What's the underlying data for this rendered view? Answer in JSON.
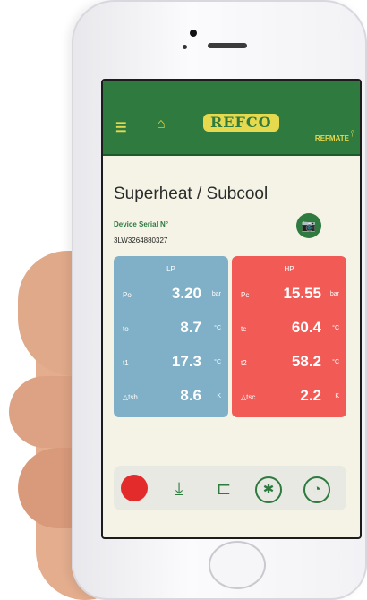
{
  "app": {
    "logo": "REFCO",
    "brand": "REFMATE"
  },
  "header": {
    "menu_icon": "☰",
    "home_icon": "⌂",
    "refmate_icon": "⫯"
  },
  "page": {
    "title": "Superheat / Subcool"
  },
  "device": {
    "serial_label": "Device Serial N°",
    "serial_value": "3LW3264880327",
    "camera_icon": "📷"
  },
  "lp": {
    "title": "LP",
    "rows": [
      {
        "sym": "Po",
        "value": "3.20",
        "unit": "bar"
      },
      {
        "sym": "to",
        "value": "8.7",
        "unit": "°C"
      },
      {
        "sym": "t1",
        "value": "17.3",
        "unit": "°C"
      },
      {
        "sym": "△tsh",
        "value": "8.6",
        "unit": "K"
      }
    ]
  },
  "hp": {
    "title": "HP",
    "rows": [
      {
        "sym": "Pc",
        "value": "15.55",
        "unit": "bar"
      },
      {
        "sym": "tc",
        "value": "60.4",
        "unit": "°C"
      },
      {
        "sym": "t2",
        "value": "58.2",
        "unit": "°C"
      },
      {
        "sym": "△tsc",
        "value": "2.2",
        "unit": "K"
      }
    ]
  },
  "toolbar": {
    "download_icon": "⤓",
    "probe_icon": "⊏",
    "fan_icon": "✱",
    "gauge_icon": "◔"
  },
  "colors": {
    "accent_green": "#2e7a3f",
    "accent_yellow": "#e7d94e",
    "lp_blue": "#7fb0c7",
    "hp_red": "#f25a56",
    "record_red": "#e32b2b"
  }
}
